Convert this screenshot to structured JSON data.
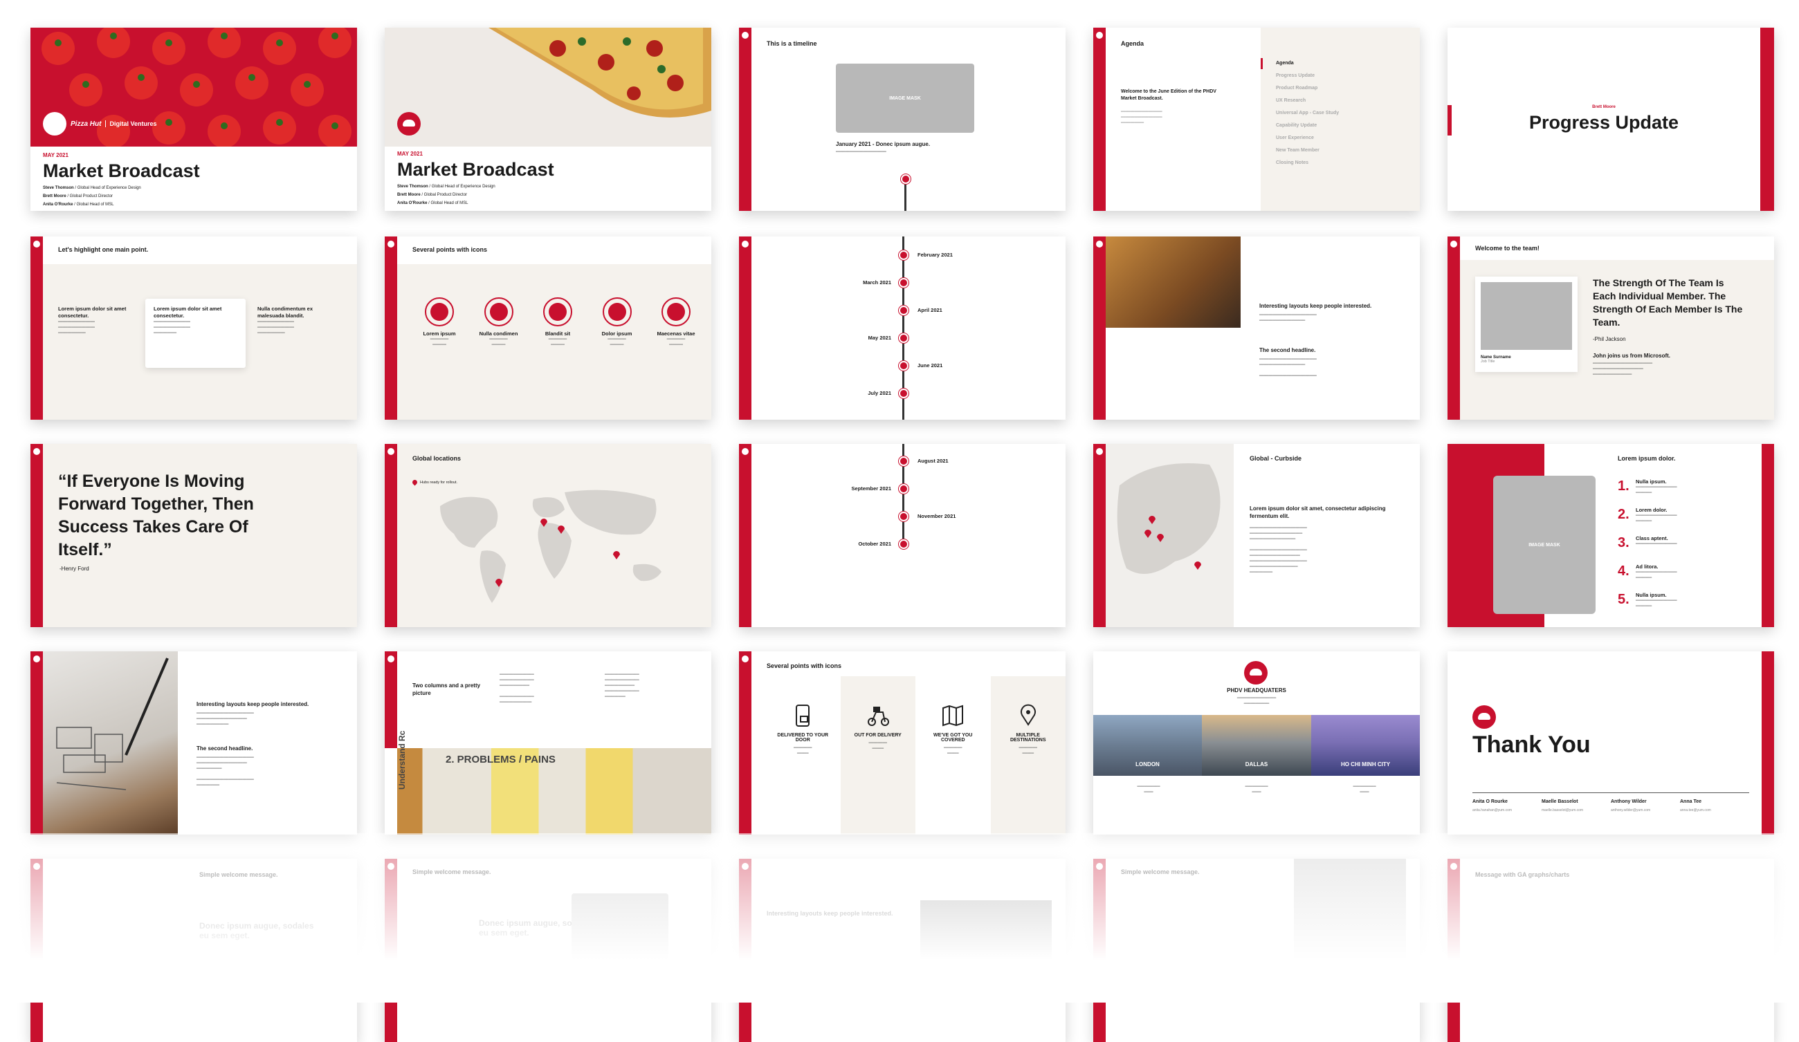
{
  "s1": {
    "month": "MAY 2021",
    "title": "Market Broadcast",
    "people": [
      {
        "name": "Steve Thomson",
        "role": " / Global Head of Experience Design"
      },
      {
        "name": "Brett Moore",
        "role": " / Global Product Director"
      },
      {
        "name": "Anita O'Rourke",
        "role": " / Global Head of MSL"
      }
    ],
    "brand1": "Pizza Hut",
    "brand2": "Digital Ventures"
  },
  "s2": {
    "month": "MAY 2021",
    "title": "Market Broadcast",
    "people": [
      {
        "name": "Steve Thomson",
        "role": " / Global Head of Experience Design"
      },
      {
        "name": "Brett Moore",
        "role": " / Global Product Director"
      },
      {
        "name": "Anita O'Rourke",
        "role": " / Global Head of MSL"
      }
    ]
  },
  "s3": {
    "heading": "This is a timeline",
    "mask": "IMAGE MASK",
    "event": "January 2021 - Donec ipsum augue."
  },
  "s4": {
    "heading": "Agenda",
    "welcome": "Welcome to the June Edition of the PHDV Market Broadcast.",
    "items": [
      "Agenda",
      "Progress Update",
      "Product Roadmap",
      "UX Research",
      "Universal App - Case Study",
      "Capability Update",
      "User Experience",
      "New Team Member",
      "Closing Notes"
    ]
  },
  "s5": {
    "kicker": "Brett Moore",
    "title": "Progress Update"
  },
  "s6": {
    "heading": "Let's highlight one main point.",
    "cols": [
      "Lorem ipsum dolor sit amet consectetur.",
      "Lorem ipsum dolor sit amet consectetur.",
      "Nulla condimentum ex malesuada blandit."
    ]
  },
  "s7": {
    "heading": "Several points with icons",
    "items": [
      "Lorem ipsum",
      "Nulla condimen",
      "Blandit sit",
      "Dolor ipsum",
      "Maecenas vitae"
    ]
  },
  "s8": {
    "left": [
      "March 2021",
      "May 2021",
      "July 2021"
    ],
    "right": [
      "February 2021",
      "April 2021",
      "June 2021"
    ]
  },
  "s9": {
    "h1": "Interesting layouts keep people interested.",
    "h2": "The second headline."
  },
  "s10": {
    "heading": "Welcome to the team!",
    "quote": "The Strength Of The Team Is Each Individual Member. The Strength Of Each Member Is The Team.",
    "author": "-Phil Jackson",
    "join": "John joins us from Microsoft.",
    "card_name": "Name Surname",
    "card_role": "Job Title"
  },
  "s11": {
    "quote": "“If Everyone Is Moving Forward Together, Then Success Takes Care Of Itself.”",
    "author": "-Henry Ford"
  },
  "s12": {
    "heading": "Global locations",
    "legend": "Hubs ready for rollout."
  },
  "s13": {
    "left": [
      "September 2021",
      "October 2021"
    ],
    "right": [
      "August 2021",
      "November 2021"
    ]
  },
  "s14": {
    "heading": "Global - Curbside",
    "body": "Lorem ipsum dolor sit amet, consectetur adipiscing fermentum elit."
  },
  "s15": {
    "heading": "Lorem ipsum dolor.",
    "mask": "IMAGE MASK",
    "items": [
      {
        "n": "1.",
        "t": "Nulla ipsum."
      },
      {
        "n": "2.",
        "t": "Lorem dolor."
      },
      {
        "n": "3.",
        "t": "Class aptent."
      },
      {
        "n": "4.",
        "t": "Ad litora."
      },
      {
        "n": "5.",
        "t": "Nulla ipsum."
      }
    ]
  },
  "s16": {
    "h1": "Interesting layouts keep people interested.",
    "h2": "The second headline."
  },
  "s17": {
    "heading": "Two columns and a pretty picture",
    "board1": "2. PROBLEMS / PAINS",
    "board2": "Understand Rc"
  },
  "s18": {
    "heading": "Several points with icons",
    "items": [
      "DELIVERED TO YOUR DOOR",
      "OUT FOR DELIVERY",
      "WE'VE GOT YOU COVERED",
      "MULTIPLE DESTINATIONS"
    ]
  },
  "s19": {
    "heading": "PHDV HEADQUATERS",
    "cities": [
      "LONDON",
      "DALLAS",
      "HO CHI MINH CITY"
    ]
  },
  "s20": {
    "title": "Thank You",
    "people": [
      {
        "name": "Anita O Rourke",
        "email": "anita.hanahan@yum.com"
      },
      {
        "name": "Maelle Basselot",
        "email": "maelle.basselot@yum.com"
      },
      {
        "name": "Anthony Wilder",
        "email": "anthony.wilder@yum.com"
      },
      {
        "name": "Anna Tee",
        "email": "anna.tee@yum.com"
      }
    ]
  },
  "ghost": [
    "Simple welcome message.",
    "Simple welcome message.",
    "Interesting layouts keep people interested.",
    "Simple welcome message.",
    "Message with GA graphs/charts"
  ],
  "ghost_sub": [
    "Donec ipsum augue, sodales eu sem eget.",
    "Donec ipsum augue, sodales eu sem eget."
  ]
}
